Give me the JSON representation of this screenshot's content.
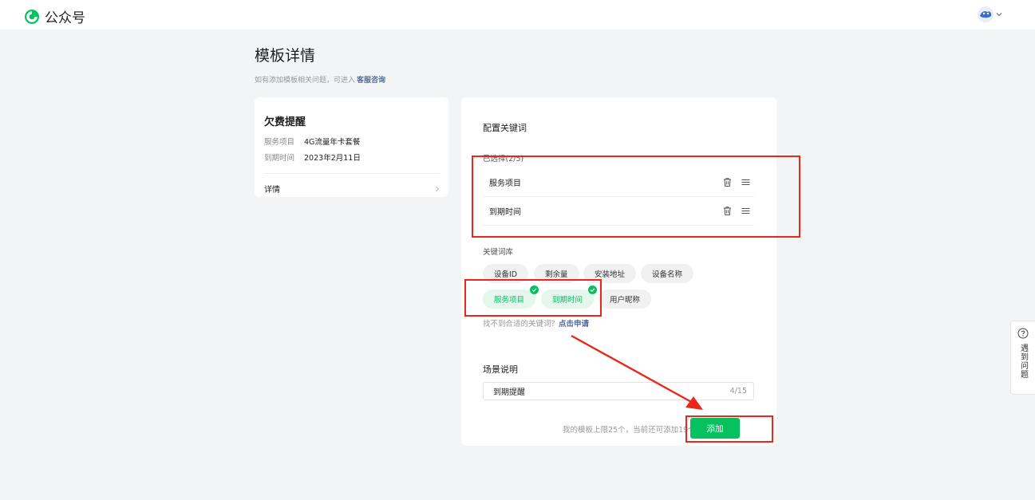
{
  "header": {
    "brand": "公众号"
  },
  "page": {
    "title": "模板详情",
    "subtitle": "如有添加模板相关问题，可进入",
    "service_link": "客服咨询"
  },
  "preview_card": {
    "title": "欠费提醒",
    "rows": [
      {
        "key": "服务项目",
        "value": "4G流量年卡套餐"
      },
      {
        "key": "到期时间",
        "value": "2023年2月11日"
      }
    ],
    "detail_label": "详情"
  },
  "config_card": {
    "title": "配置关键词",
    "selected_label": "已选择(2/5)",
    "selected_items": [
      {
        "label": "服务项目"
      },
      {
        "label": "到期时间"
      }
    ],
    "library_label": "关键词库",
    "library_tags": [
      {
        "label": "设备ID",
        "selected": false
      },
      {
        "label": "剩余量",
        "selected": false
      },
      {
        "label": "安装地址",
        "selected": false
      },
      {
        "label": "设备名称",
        "selected": false
      },
      {
        "label": "服务项目",
        "selected": true
      },
      {
        "label": "到期时间",
        "selected": true
      },
      {
        "label": "用户昵称",
        "selected": false
      }
    ],
    "help_text": "找不到合适的关键词？",
    "help_link": "点击申请",
    "scene_label": "场景说明",
    "scene_value": "到期提醒",
    "scene_count": "4/15",
    "limit_text": "我的模板上限25个，当前还可添加19个",
    "add_button": "添加"
  },
  "help_float": {
    "label": "遇到问题"
  },
  "colors": {
    "brand_green": "#07c160",
    "link_blue": "#576b95",
    "annotation_red": "#e8281b"
  }
}
